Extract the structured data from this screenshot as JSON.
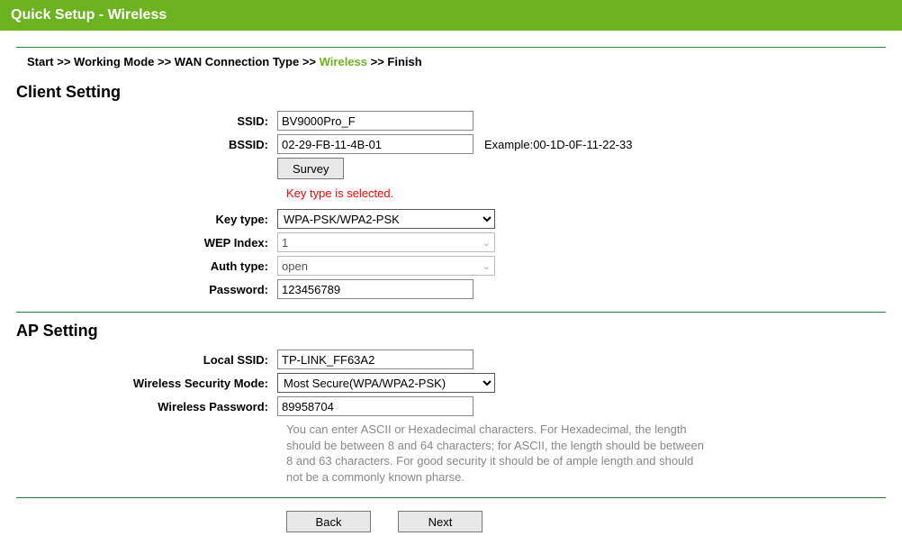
{
  "header": {
    "title": "Quick Setup - Wireless"
  },
  "breadcrumb": {
    "items": [
      {
        "label": "Start",
        "active": false
      },
      {
        "label": "Working Mode",
        "active": false
      },
      {
        "label": "WAN Connection Type",
        "active": false
      },
      {
        "label": "Wireless",
        "active": true
      },
      {
        "label": "Finish",
        "active": false
      }
    ],
    "sep": " >> "
  },
  "client": {
    "title": "Client Setting",
    "ssid_label": "SSID:",
    "ssid_value": "BV9000Pro_F",
    "bssid_label": "BSSID:",
    "bssid_value": "02-29-FB-11-4B-01",
    "bssid_example": "Example:00-1D-0F-11-22-33",
    "survey_label": "Survey",
    "key_type_hint": "Key type is selected.",
    "key_type_label": "Key type:",
    "key_type_value": "WPA-PSK/WPA2-PSK",
    "wep_index_label": "WEP Index:",
    "wep_index_value": "1",
    "auth_type_label": "Auth type:",
    "auth_type_value": "open",
    "password_label": "Password:",
    "password_value": "123456789"
  },
  "ap": {
    "title": "AP Setting",
    "local_ssid_label": "Local SSID:",
    "local_ssid_value": "TP-LINK_FF63A2",
    "sec_mode_label": "Wireless Security Mode:",
    "sec_mode_value": "Most Secure(WPA/WPA2-PSK)",
    "password_label": "Wireless Password:",
    "password_value": "89958704",
    "help": "You can enter ASCII or Hexadecimal characters. For Hexadecimal, the length should be between 8 and 64 characters; for ASCII, the length should be between 8 and 63 characters. For good security it should be of ample length and should not be a commonly known pharse."
  },
  "nav": {
    "back": "Back",
    "next": "Next"
  }
}
